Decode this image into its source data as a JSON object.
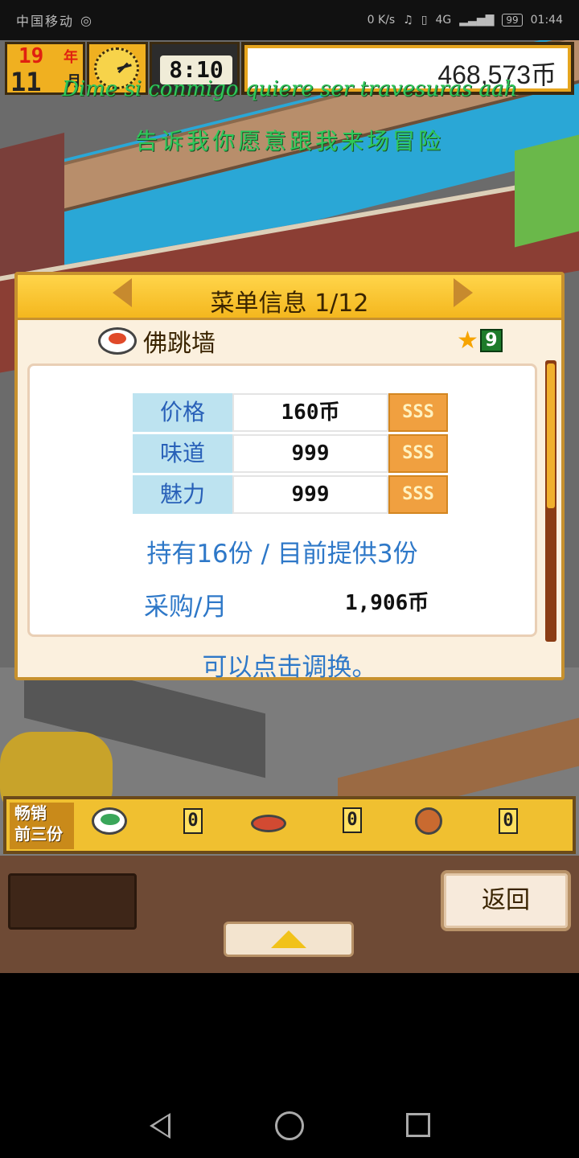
{
  "status_bar": {
    "carrier": "中国移动",
    "network_speed": "0 K/s",
    "signal": "4G",
    "battery": "99",
    "time": "01:44"
  },
  "hud": {
    "year_value": "19",
    "year_label": "年",
    "month_value": "11",
    "month_label": "月",
    "clock_icon": "clock-icon",
    "time": "8:10",
    "money": "468,573币"
  },
  "lyrics": {
    "line1": "Dime si conmigo quiere ser travesuras aah",
    "line2": "告诉我你愿意跟我来场冒险"
  },
  "dialog": {
    "title": "菜单信息 1/12",
    "dish_name": "佛跳墙",
    "star_count": "9",
    "stats": [
      {
        "label": "价格",
        "value": "160币",
        "grade": "SSS"
      },
      {
        "label": "味道",
        "value": "999",
        "grade": "SSS"
      },
      {
        "label": "魅力",
        "value": "999",
        "grade": "SSS"
      }
    ],
    "holding": "持有16份 / 目前提供3份",
    "purchase_label": "采购/月",
    "purchase_value": "1,906币",
    "hint": "可以点击调换。"
  },
  "bestseller": {
    "label_line1": "畅销",
    "label_line2": "前三份",
    "items": [
      {
        "icon": "salad-dish-icon",
        "count": "0"
      },
      {
        "icon": "meat-dish-icon",
        "count": "0"
      },
      {
        "icon": "bun-dish-icon",
        "count": "0"
      }
    ]
  },
  "bottom": {
    "back_label": "返回",
    "up_icon": "up-arrow-icon"
  },
  "colors": {
    "accent_text": "#2e78c8",
    "header_gold": "#f4b71e",
    "lyric_green": "#2ec85a"
  }
}
